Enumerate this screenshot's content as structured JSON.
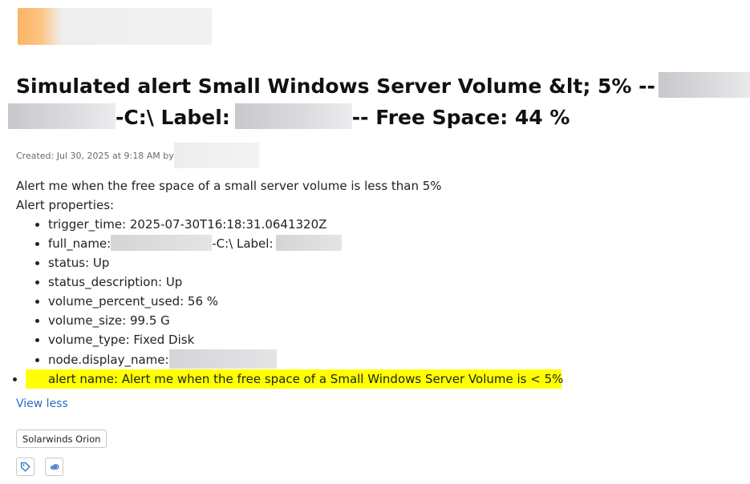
{
  "header": {
    "logo_icon": "redacted-logo"
  },
  "title": {
    "part1": "Simulated alert Small Windows Server Volume &lt; 5% --",
    "part2": "-C:\\ Label:",
    "part3": "-- Free Space: 44 %"
  },
  "meta": {
    "created": "Created: Jul 30, 2025 at 9:18 AM by"
  },
  "description": {
    "summary": "Alert me when the free space of a small server volume is less than 5%",
    "properties_heading": "Alert properties:",
    "properties": {
      "trigger_time": "trigger_time: 2025-07-30T16:18:31.0641320Z",
      "full_name_prefix": "full_name:",
      "full_name_middle": "-C:\\ Label:",
      "status": "status: Up",
      "status_description": "status_description: Up",
      "volume_percent_used": "volume_percent_used: 56 %",
      "volume_size": "volume_size: 99.5 G",
      "volume_type": "volume_type: Fixed Disk",
      "node_display_name": "node.display_name:",
      "alert_name": "alert name: Alert me when the free space of a Small Windows Server Volume is < 5%"
    }
  },
  "actions": {
    "view_less": "View less",
    "tag": "Solarwinds Orion",
    "tag_icon": "tag-icon",
    "attach_icon": "paperclip-icon"
  },
  "colors": {
    "highlight": "#ffff00",
    "link": "#2b6cc4",
    "accent_logo": "#fbb466"
  }
}
